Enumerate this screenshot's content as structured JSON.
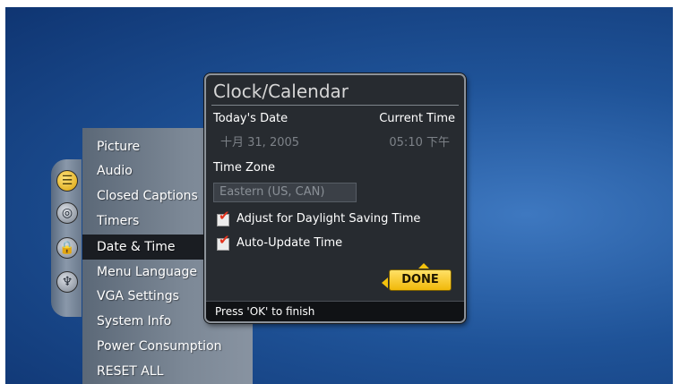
{
  "colors": {
    "background": "#1f5398",
    "accent": "#f4c20d",
    "checkmark": "#e3341f",
    "selected_row": "#1a1d22"
  },
  "categories": [
    {
      "name": "settings",
      "icon": "settings-icon",
      "glyph": "☰"
    },
    {
      "name": "antenna",
      "icon": "antenna-icon",
      "glyph": "◎"
    },
    {
      "name": "lock",
      "icon": "lock-icon",
      "glyph": "🔒"
    },
    {
      "name": "plug",
      "icon": "plug-icon",
      "glyph": "♆"
    }
  ],
  "menu": {
    "items": [
      {
        "label": "Picture"
      },
      {
        "label": "Audio"
      },
      {
        "label": "Closed Captions"
      },
      {
        "label": "Timers"
      },
      {
        "label": "Date & Time"
      },
      {
        "label": "Menu Language"
      },
      {
        "label": "VGA Settings"
      },
      {
        "label": "System Info"
      },
      {
        "label": "Power Consumption"
      },
      {
        "label": "RESET ALL"
      }
    ],
    "selected": "Date & Time"
  },
  "dialog": {
    "title": "Clock/Calendar",
    "todays_date_label": "Today's Date",
    "todays_date_value": "十月 31, 2005",
    "current_time_label": "Current Time",
    "current_time_value": "05:10 下午",
    "time_zone_label": "Time Zone",
    "time_zone_value": "Eastern (US, CAN)",
    "options": [
      {
        "label": "Adjust for Daylight Saving Time",
        "checked": true
      },
      {
        "label": "Auto-Update Time",
        "checked": true
      }
    ],
    "done_label": "DONE",
    "status_text": "Press 'OK' to finish"
  }
}
